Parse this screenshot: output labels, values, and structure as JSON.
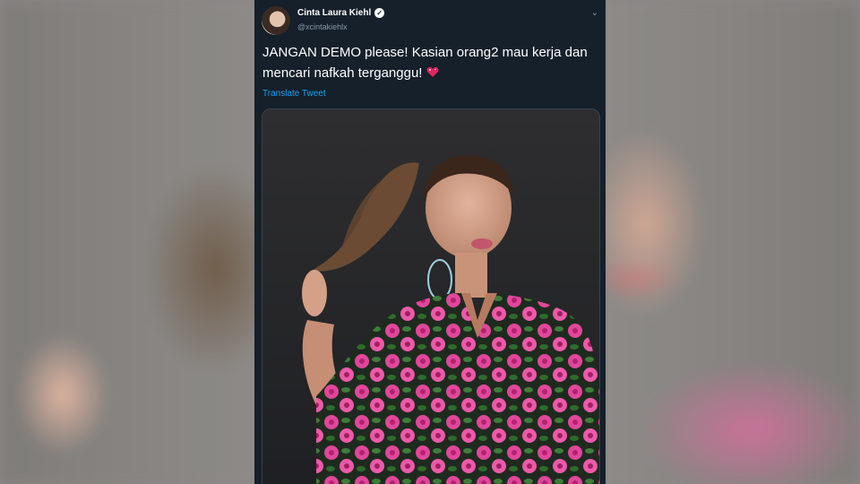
{
  "tweet": {
    "display_name": "Cinta Laura Kiehl",
    "handle": "@xcintakiehlx",
    "verified_icon": "verified-badge-icon",
    "menu_icon": "chevron-down-icon",
    "text": "JANGAN DEMO please! Kasian orang2 mau kerja dan mencari nafkah terganggu!",
    "emoji": "sparkling-heart-icon",
    "translate_label": "Translate Tweet"
  },
  "colors": {
    "background": "#15202b",
    "text": "#ffffff",
    "secondary": "#8899a6",
    "link": "#1da1f2",
    "dress_pink": "#e0479a"
  }
}
